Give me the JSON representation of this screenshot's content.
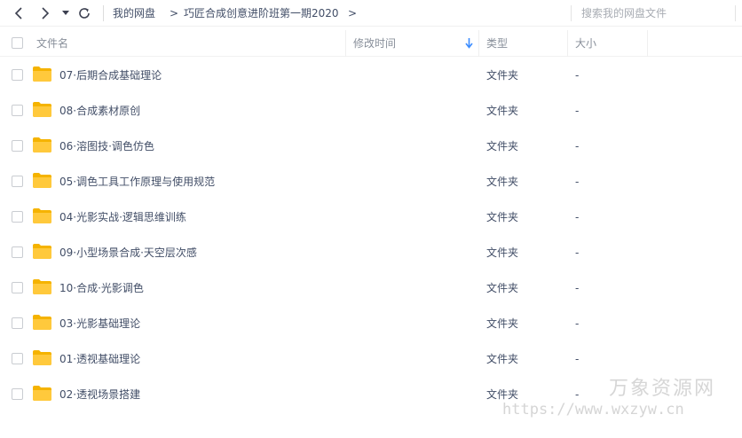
{
  "toolbar": {
    "back_icon": "chevron-left-icon",
    "forward_icon": "chevron-right-icon",
    "history_icon": "caret-down-icon",
    "refresh_icon": "refresh-icon"
  },
  "breadcrumb": {
    "root": "我的网盘",
    "separator": ">",
    "current": "巧匠合成创意进阶班第一期2020",
    "trailing_separator": ">"
  },
  "search": {
    "placeholder": "搜索我的网盘文件"
  },
  "table": {
    "columns": {
      "name": "文件名",
      "modified": "修改时间",
      "type": "类型",
      "size": "大小"
    },
    "sort_icon": "sort-down-arrow-icon",
    "rows": [
      {
        "name": "07·后期合成基础理论",
        "type": "文件夹",
        "size": "-"
      },
      {
        "name": "08·合成素材原创",
        "type": "文件夹",
        "size": "-"
      },
      {
        "name": "06·溶图技·调色仿色",
        "type": "文件夹",
        "size": "-"
      },
      {
        "name": "05·调色工具工作原理与使用规范",
        "type": "文件夹",
        "size": "-"
      },
      {
        "name": "04·光影实战·逻辑思维训练",
        "type": "文件夹",
        "size": "-"
      },
      {
        "name": "09·小型场景合成·天空层次感",
        "type": "文件夹",
        "size": "-"
      },
      {
        "name": "10·合成·光影调色",
        "type": "文件夹",
        "size": "-"
      },
      {
        "name": "03·光影基础理论",
        "type": "文件夹",
        "size": "-"
      },
      {
        "name": "01·透视基础理论",
        "type": "文件夹",
        "size": "-"
      },
      {
        "name": "02·透视场景搭建",
        "type": "文件夹",
        "size": "-"
      }
    ]
  },
  "watermark": {
    "title": "万象资源网",
    "url": "https://www.wxzyw.cn"
  },
  "colors": {
    "folder": "#ffc93c",
    "folder_dark": "#f5b300",
    "text": "#424e67",
    "header_text": "#888f9a",
    "sort_arrow": "#3b8cff"
  }
}
